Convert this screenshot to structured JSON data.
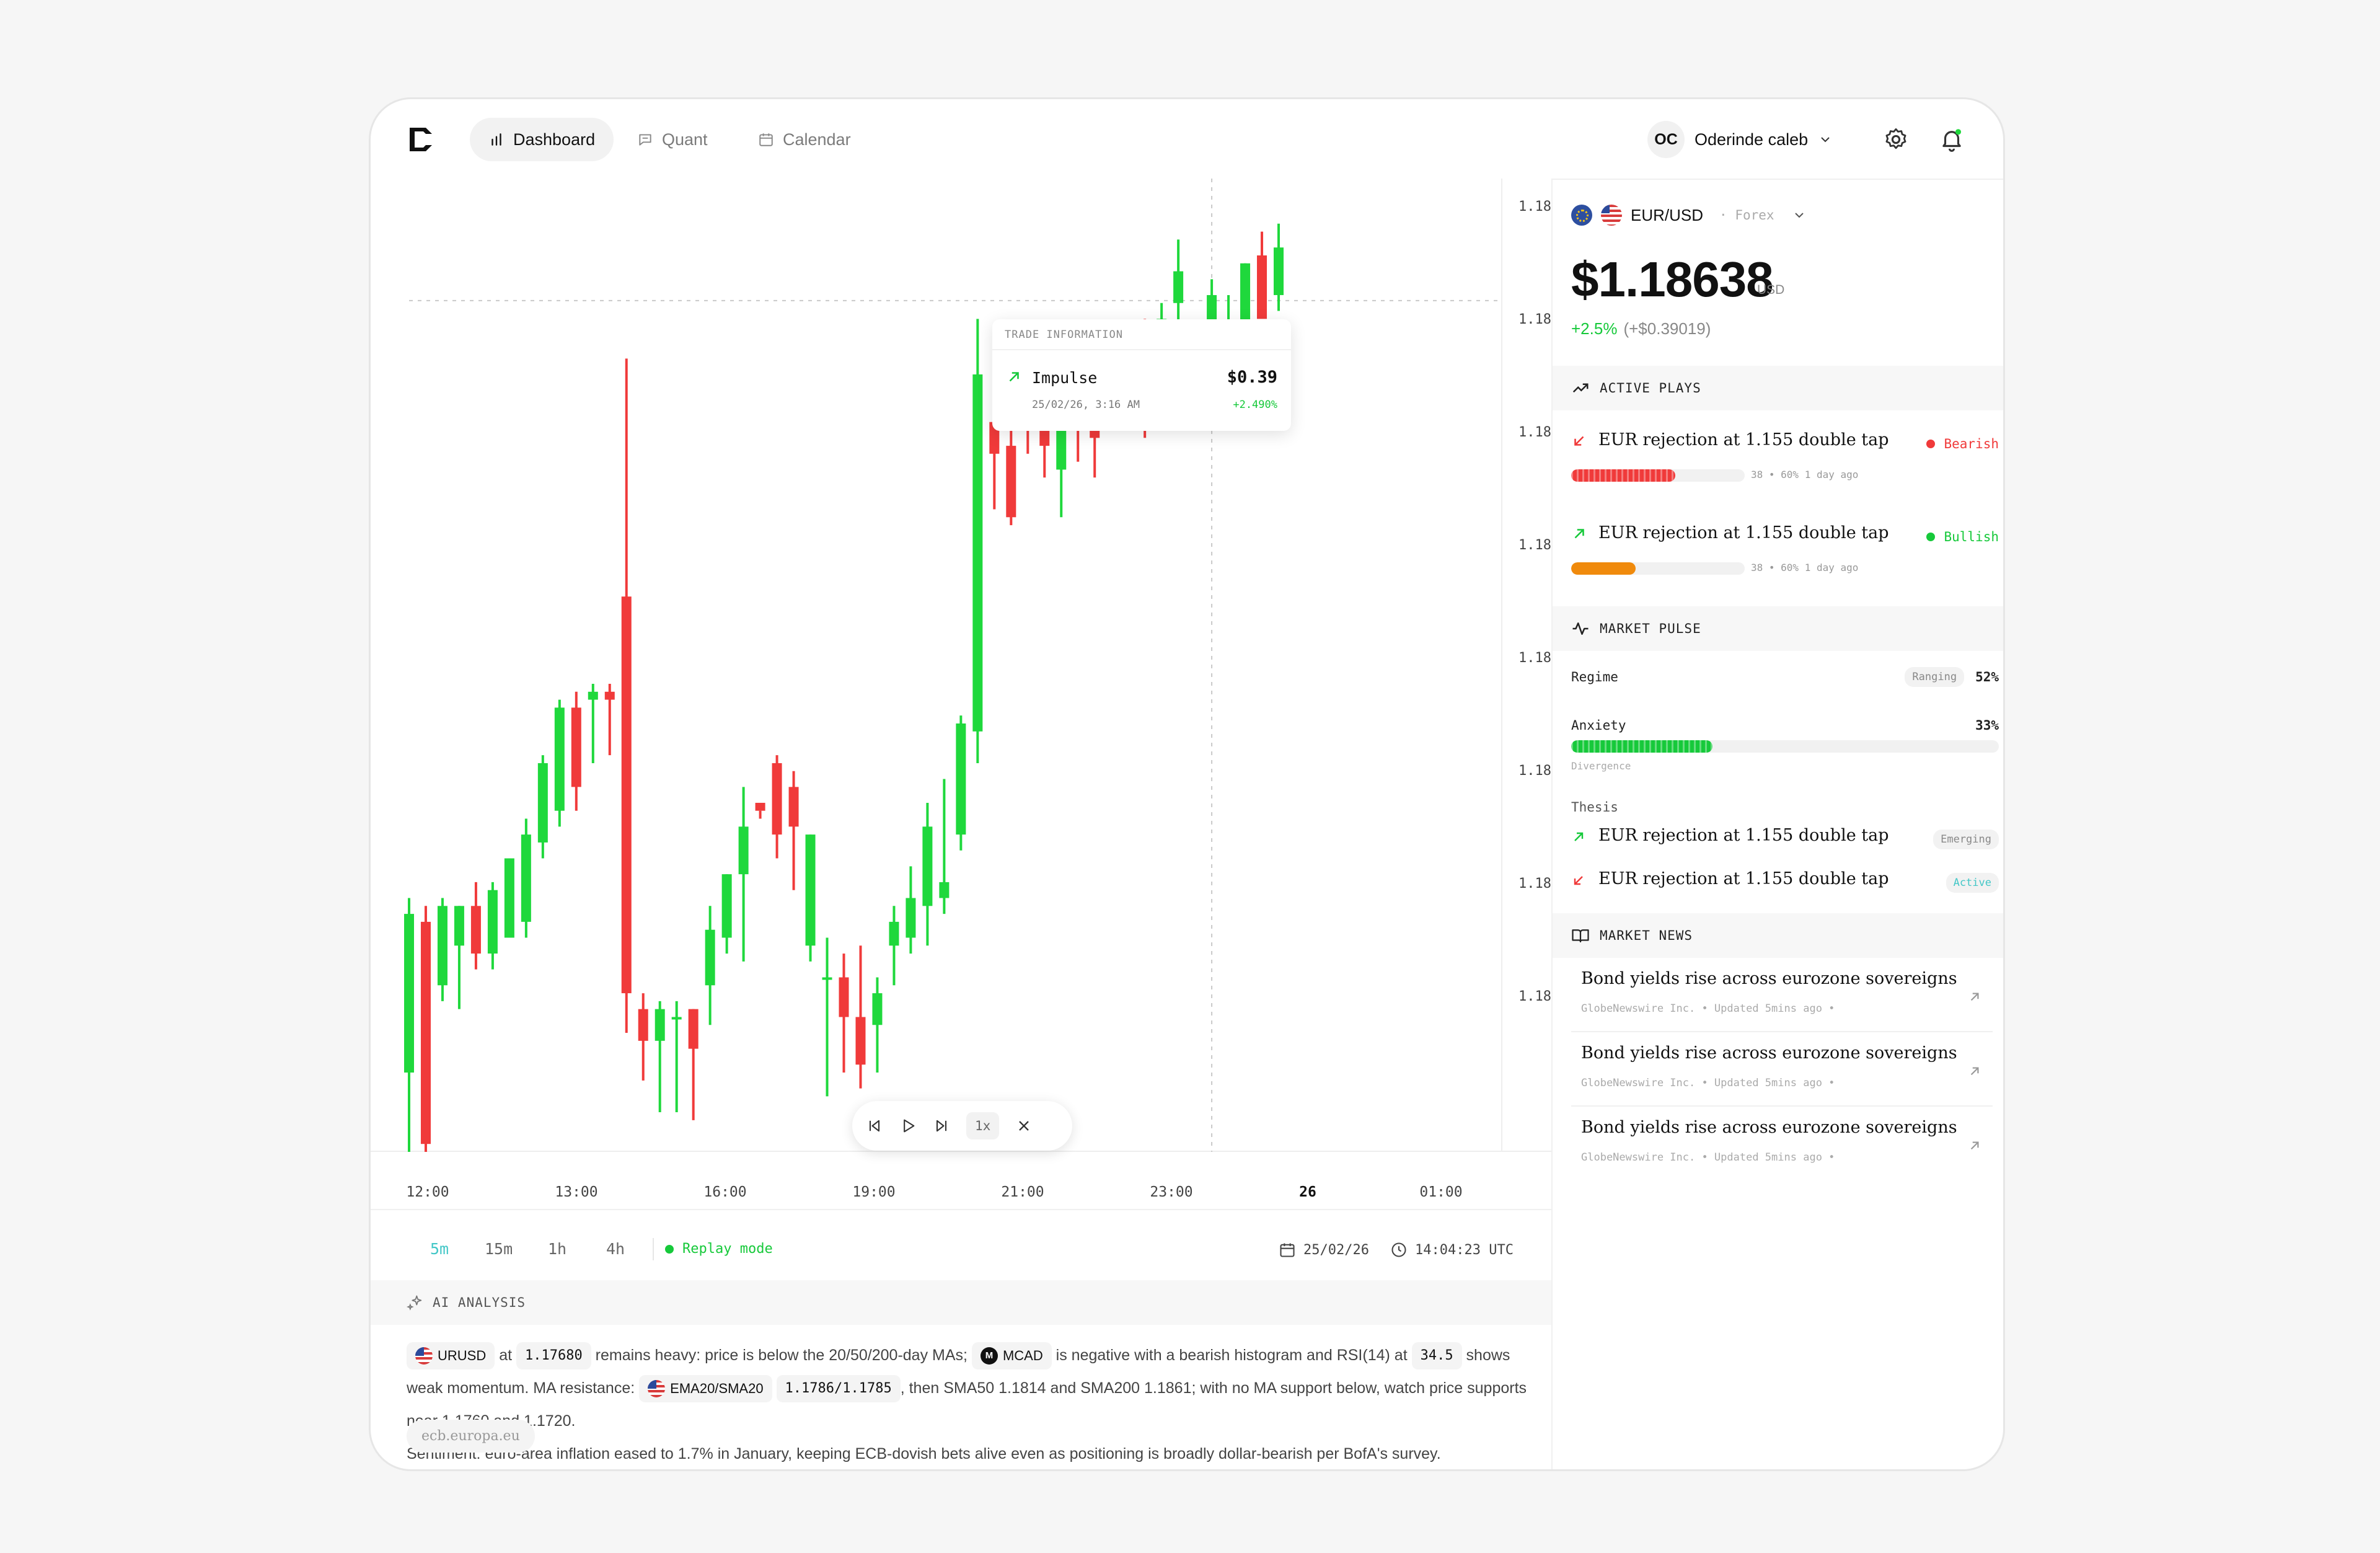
{
  "nav": {
    "items": [
      {
        "label": "Dashboard",
        "icon": "bar-chart-icon",
        "active": true
      },
      {
        "label": "Quant",
        "icon": "chat-icon",
        "active": false
      },
      {
        "label": "Calendar",
        "icon": "calendar-icon",
        "active": false
      }
    ],
    "user": {
      "initials": "OC",
      "name": "Oderinde caleb"
    }
  },
  "chart": {
    "y_labels": [
      "1.18",
      "1.18",
      "1.18",
      "1.18",
      "1.18",
      "1.18",
      "1.18",
      "1.18"
    ],
    "x_labels": [
      {
        "label": "12:00",
        "bold": false
      },
      {
        "label": "13:00",
        "bold": false
      },
      {
        "label": "16:00",
        "bold": false
      },
      {
        "label": "19:00",
        "bold": false
      },
      {
        "label": "21:00",
        "bold": false
      },
      {
        "label": "23:00",
        "bold": false
      },
      {
        "label": "26",
        "bold": true
      },
      {
        "label": "01:00",
        "bold": false
      }
    ],
    "tooltip": {
      "header": "TRADE INFORMATION",
      "name": "Impulse",
      "value": "$0.39",
      "date": "25/02/26, 3:16 AM",
      "change": "+2.490%"
    },
    "replay": {
      "speed": "1x"
    }
  },
  "chart_data": {
    "type": "candlestick",
    "x_labels": [
      "12:00",
      "13:00",
      "16:00",
      "19:00",
      "21:00",
      "23:00",
      "26",
      "01:00"
    ],
    "y_tick_labels": [
      "1.18",
      "1.18",
      "1.18",
      "1.18",
      "1.18",
      "1.18",
      "1.18",
      "1.18"
    ],
    "candles": [
      {
        "o": 1.1715,
        "h": 1.1737,
        "l": 1.1705,
        "c": 1.1735
      },
      {
        "o": 1.1734,
        "h": 1.1736,
        "l": 1.1705,
        "c": 1.1706
      },
      {
        "o": 1.1726,
        "h": 1.1737,
        "l": 1.1724,
        "c": 1.1736
      },
      {
        "o": 1.1731,
        "h": 1.1736,
        "l": 1.1723,
        "c": 1.1736
      },
      {
        "o": 1.1736,
        "h": 1.1739,
        "l": 1.1728,
        "c": 1.173
      },
      {
        "o": 1.173,
        "h": 1.1739,
        "l": 1.1728,
        "c": 1.1738
      },
      {
        "o": 1.1732,
        "h": 1.1742,
        "l": 1.1732,
        "c": 1.1742
      },
      {
        "o": 1.1734,
        "h": 1.1747,
        "l": 1.1732,
        "c": 1.1745
      },
      {
        "o": 1.1744,
        "h": 1.1755,
        "l": 1.1742,
        "c": 1.1754
      },
      {
        "o": 1.1748,
        "h": 1.1762,
        "l": 1.1746,
        "c": 1.1761
      },
      {
        "o": 1.1761,
        "h": 1.1763,
        "l": 1.1748,
        "c": 1.1751
      },
      {
        "o": 1.1762,
        "h": 1.1764,
        "l": 1.1754,
        "c": 1.1763
      },
      {
        "o": 1.1763,
        "h": 1.1764,
        "l": 1.1755,
        "c": 1.1762
      },
      {
        "o": 1.1775,
        "h": 1.1805,
        "l": 1.172,
        "c": 1.1725
      },
      {
        "o": 1.1723,
        "h": 1.1725,
        "l": 1.1714,
        "c": 1.1719
      },
      {
        "o": 1.1719,
        "h": 1.1724,
        "l": 1.171,
        "c": 1.1723
      },
      {
        "o": 1.1722,
        "h": 1.1724,
        "l": 1.171,
        "c": 1.1722
      },
      {
        "o": 1.1723,
        "h": 1.1723,
        "l": 1.1709,
        "c": 1.1718
      },
      {
        "o": 1.1726,
        "h": 1.1736,
        "l": 1.1721,
        "c": 1.1733
      },
      {
        "o": 1.1732,
        "h": 1.174,
        "l": 1.173,
        "c": 1.174
      },
      {
        "o": 1.174,
        "h": 1.1751,
        "l": 1.1729,
        "c": 1.1746
      },
      {
        "o": 1.1749,
        "h": 1.1748,
        "l": 1.1747,
        "c": 1.1748
      },
      {
        "o": 1.1754,
        "h": 1.1755,
        "l": 1.1742,
        "c": 1.1745
      },
      {
        "o": 1.1751,
        "h": 1.1753,
        "l": 1.1738,
        "c": 1.1746
      },
      {
        "o": 1.1731,
        "h": 1.1745,
        "l": 1.1729,
        "c": 1.1745
      },
      {
        "o": 1.1727,
        "h": 1.1732,
        "l": 1.1712,
        "c": 1.1727
      },
      {
        "o": 1.1727,
        "h": 1.173,
        "l": 1.1715,
        "c": 1.1722
      },
      {
        "o": 1.1722,
        "h": 1.1731,
        "l": 1.1713,
        "c": 1.1716
      },
      {
        "o": 1.1721,
        "h": 1.1727,
        "l": 1.1715,
        "c": 1.1725
      },
      {
        "o": 1.1731,
        "h": 1.1736,
        "l": 1.1726,
        "c": 1.1734
      },
      {
        "o": 1.1732,
        "h": 1.1741,
        "l": 1.173,
        "c": 1.1737
      },
      {
        "o": 1.1736,
        "h": 1.1749,
        "l": 1.1731,
        "c": 1.1746
      },
      {
        "o": 1.1737,
        "h": 1.1752,
        "l": 1.1735,
        "c": 1.1739
      },
      {
        "o": 1.1745,
        "h": 1.176,
        "l": 1.1743,
        "c": 1.1759
      },
      {
        "o": 1.1758,
        "h": 1.181,
        "l": 1.1754,
        "c": 1.1803
      },
      {
        "o": 1.1797,
        "h": 1.1802,
        "l": 1.1786,
        "c": 1.1793
      },
      {
        "o": 1.1794,
        "h": 1.1798,
        "l": 1.1784,
        "c": 1.1785
      },
      {
        "o": 1.1806,
        "h": 1.1808,
        "l": 1.1793,
        "c": 1.18
      },
      {
        "o": 1.1803,
        "h": 1.1808,
        "l": 1.179,
        "c": 1.1794
      },
      {
        "o": 1.1791,
        "h": 1.1808,
        "l": 1.1785,
        "c": 1.1805
      },
      {
        "o": 1.1803,
        "h": 1.1806,
        "l": 1.1792,
        "c": 1.1797
      },
      {
        "o": 1.1802,
        "h": 1.1808,
        "l": 1.179,
        "c": 1.1795
      },
      {
        "o": 1.1804,
        "h": 1.1808,
        "l": 1.1801,
        "c": 1.1806
      },
      {
        "o": 1.1797,
        "h": 1.1806,
        "l": 1.1796,
        "c": 1.1803
      },
      {
        "o": 1.1806,
        "h": 1.181,
        "l": 1.1795,
        "c": 1.1798
      },
      {
        "o": 1.1805,
        "h": 1.1812,
        "l": 1.1805,
        "c": 1.181
      },
      {
        "o": 1.1812,
        "h": 1.182,
        "l": 1.1807,
        "c": 1.1816
      },
      {
        "o": 1.1808,
        "h": 1.1808,
        "l": 1.1806,
        "c": 1.1807
      },
      {
        "o": 1.1807,
        "h": 1.1815,
        "l": 1.1806,
        "c": 1.1813
      },
      {
        "o": 1.1808,
        "h": 1.1813,
        "l": 1.1806,
        "c": 1.1808
      },
      {
        "o": 1.1808,
        "h": 1.1817,
        "l": 1.1806,
        "c": 1.1817
      },
      {
        "o": 1.1818,
        "h": 1.1821,
        "l": 1.1811,
        "c": 1.181
      },
      {
        "o": 1.1813,
        "h": 1.1822,
        "l": 1.1811,
        "c": 1.1819
      }
    ],
    "ylim": [
      1.1705,
      1.1823
    ],
    "current_price_line": 1.18123,
    "colors": {
      "up": "#1fd83c",
      "down": "#f03a3a"
    }
  },
  "timeframes": {
    "items": [
      {
        "label": "5m",
        "active": true
      },
      {
        "label": "15m",
        "active": false
      },
      {
        "label": "1h",
        "active": false
      },
      {
        "label": "4h",
        "active": false
      }
    ],
    "replay_label": "Replay mode",
    "date": "25/02/26",
    "time": "14:04:23 UTC"
  },
  "ai": {
    "header": "AI ANALYSIS",
    "chip_pair": "URUSD",
    "at1": "at",
    "price_chip": "1.17680",
    "t1": "remains heavy: price is below the 20/50/200-day MAs;",
    "chip_macd": "MCAD",
    "t2": "is negative with a bearish histogram and RSI(14)",
    "at2": "at",
    "rsi_chip": "34.5",
    "t3": "shows weak momentum. MA resistance:",
    "chip_ema": "EMA20/SMA20",
    "ema_val": "1.1786/1.1785",
    "t4": ", then SMA50 1.1814 and SMA200 1.1861; with no MA support below, watch price supports near 1.1760 and 1.1720.",
    "sentiment": "Sentiment: euro-area inflation eased to 1.7% in January, keeping ECB-dovish bets alive even as positioning is broadly dollar-bearish per BofA's survey.",
    "source": "ecb.europa.eu"
  },
  "panel": {
    "pair": "EUR/USD",
    "market": "Forex",
    "price": "$1.18638",
    "currency": "USD",
    "change_pct": "+2.5%",
    "change_abs": "(+$0.39019)",
    "active_plays_title": "ACTIVE PLAYS",
    "plays": [
      {
        "title": "EUR rejection at 1.155 double tap",
        "tag": "Bearish",
        "direction": "down",
        "progress": 0.6,
        "meta": "38 • 60% 1 day ago",
        "color": "#f03a3a"
      },
      {
        "title": "EUR rejection at 1.155 double tap",
        "tag": "Bullish",
        "direction": "up",
        "progress": 0.37,
        "meta": "38 • 60% 1 day ago",
        "color": "#f08a0c"
      }
    ],
    "pulse_title": "MARKET PULSE",
    "regime_label": "Regime",
    "regime_badge": "Ranging",
    "regime_pct": "52%",
    "anxiety_label": "Anxiety",
    "anxiety_pct": "33%",
    "anxiety_value": 0.33,
    "divergence_label": "Divergence",
    "thesis_label": "Thesis",
    "thesis": [
      {
        "title": "EUR rejection at 1.155 double tap",
        "badge": "Emerging",
        "direction": "up"
      },
      {
        "title": "EUR rejection at 1.155 double tap",
        "badge": "Active",
        "direction": "down"
      }
    ],
    "news_title": "MARKET NEWS",
    "news": [
      {
        "headline": "Bond yields rise across eurozone sovereigns",
        "meta": "GlobeNewswire Inc. • Updated 5mins ago •"
      },
      {
        "headline": "Bond yields rise across eurozone sovereigns",
        "meta": "GlobeNewswire Inc. • Updated 5mins ago •"
      },
      {
        "headline": "Bond yields rise across eurozone sovereigns",
        "meta": "GlobeNewswire Inc. • Updated 5mins ago •"
      }
    ]
  }
}
